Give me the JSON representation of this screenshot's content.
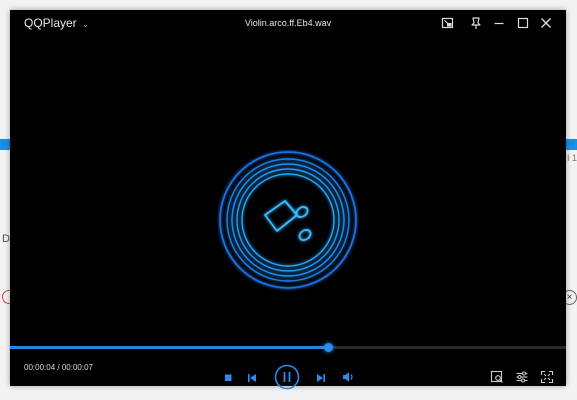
{
  "app": {
    "name": "QQPlayer"
  },
  "window": {
    "file_title": "Violin.arco.ff.Eb4.wav"
  },
  "playback": {
    "current_time": "00:00:04",
    "separator": "/",
    "total_time": "00:00:07",
    "progress_fraction": 0.5714
  },
  "background": {
    "left_letter": "D",
    "right_fragment": "I 1",
    "close_glyph": "×"
  },
  "icons": {
    "titlebar": [
      "picture-in-picture-icon",
      "pin-icon",
      "minimize-icon",
      "maximize-icon",
      "close-icon"
    ],
    "controls": [
      "stop-icon",
      "previous-icon",
      "pause-icon",
      "next-icon",
      "volume-icon"
    ],
    "right_controls": [
      "screenshot-icon",
      "settings-icon",
      "fullscreen-icon"
    ],
    "center": "music-note-icon"
  },
  "colors": {
    "accent": "#1e88e5",
    "background": "#000000",
    "disc_glow": "#1fa8ff"
  }
}
